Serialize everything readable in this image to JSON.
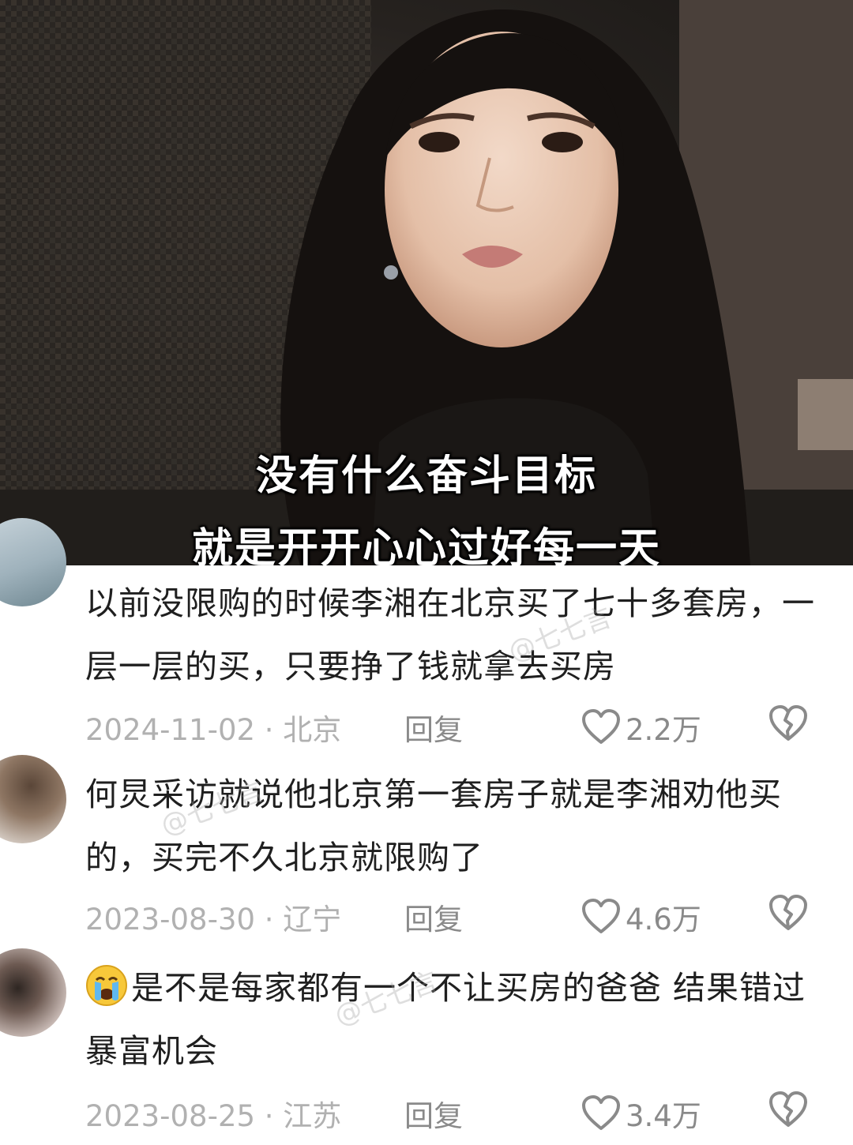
{
  "video": {
    "subtitle_line1": "没有什么奋斗目标",
    "subtitle_line2": "就是开开心心过好每一天"
  },
  "watermark": "@七七言",
  "comments": [
    {
      "text": "以前没限购的时候李湘在北京买了七十多套房，一层一层的买，只要挣了钱就拿去买房",
      "date_location": "2024-11-02 · 北京",
      "reply_label": "回复",
      "likes": "2.2万"
    },
    {
      "text": "何炅采访就说他北京第一套房子就是李湘劝他买的，买完不久北京就限购了",
      "date_location": "2023-08-30 · 辽宁",
      "reply_label": "回复",
      "likes": "4.6万"
    },
    {
      "text": "是不是每家都有一个不让买房的爸爸 结果错过暴富机会",
      "date_location": "2023-08-25 · 江苏",
      "reply_label": "回复",
      "likes": "3.4万"
    }
  ],
  "colors": {
    "text": "#1f1f1f",
    "meta": "#b1b1b1",
    "icon": "#8a8a8a"
  }
}
